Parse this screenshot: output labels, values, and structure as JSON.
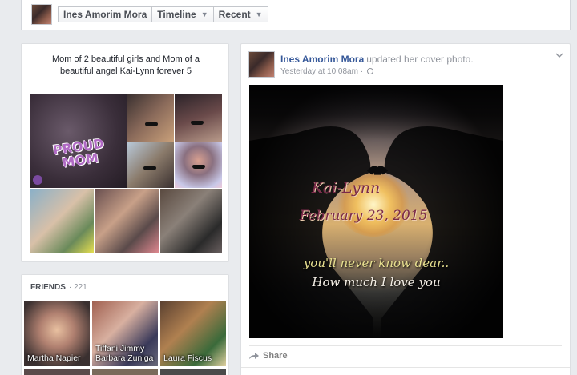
{
  "topbar": {
    "name": "Ines Amorim Mora",
    "timeline": "Timeline",
    "recent": "Recent"
  },
  "intro": {
    "bio": "Mom of 2 beautiful girls and Mom of a beautiful angel Kai-Lynn forever 5",
    "collage_text": "PROUD MOM"
  },
  "friends": {
    "header": "FRIENDS",
    "count": "221",
    "items": [
      {
        "name": "Martha Napier"
      },
      {
        "name": "Tiffani Jimmy Barbara Zuniga"
      },
      {
        "name": "Laura Fiscus"
      }
    ]
  },
  "post": {
    "author": "Ines Amorim Mora",
    "action": "updated her cover photo.",
    "time": "Yesterday at 10:08am",
    "dot": "·",
    "cover_text": {
      "name": "Kai-Lynn",
      "date": "February 23, 2015",
      "line1": "you'll never know dear..",
      "line2": "How much I love you"
    },
    "share": "Share"
  },
  "icons": {
    "dropdown": "chevron-down-icon",
    "privacy": "globe-icon",
    "share": "share-icon"
  },
  "colors": {
    "link": "#365899",
    "background": "#e9ebee"
  }
}
